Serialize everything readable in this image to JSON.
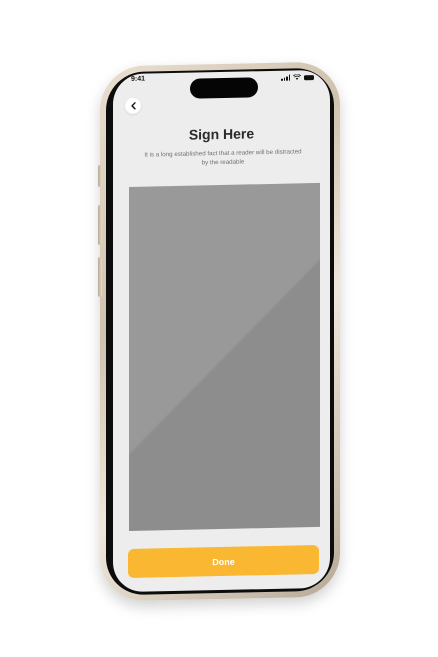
{
  "status_bar": {
    "time": "9:41",
    "icons": [
      "signal-icon",
      "wifi-icon",
      "battery-icon"
    ]
  },
  "header": {
    "back_icon": "chevron-left-icon",
    "title": "Sign Here",
    "subtitle": "It is a long established fact that a reader will be distracted by the readable"
  },
  "signature_pad": {
    "content": ""
  },
  "actions": {
    "done_label": "Done"
  },
  "colors": {
    "accent": "#f9b732",
    "screen_background": "#ededed",
    "pad_fill": "#999999",
    "title_text": "#2b2b2b",
    "subtitle_text": "#707070"
  }
}
